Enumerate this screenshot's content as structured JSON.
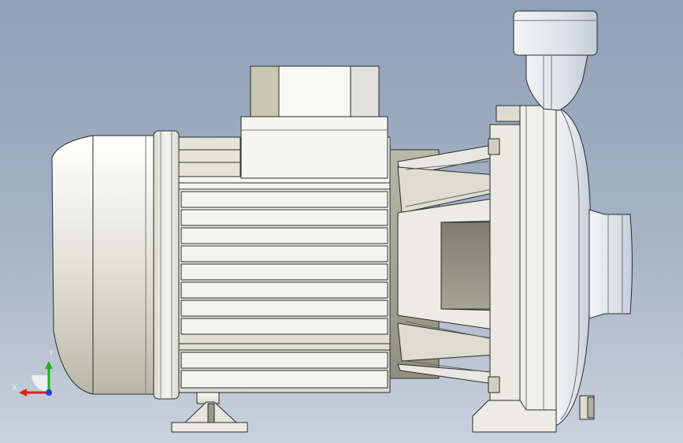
{
  "viewport": {
    "background_top": "#8f9fb6",
    "background_bottom": "#c9d2dd"
  },
  "model": {
    "name": "centrifugal-pump-with-motor",
    "body_color": "#eeeeea",
    "edge_color": "#2b2b2b"
  },
  "triad": {
    "x_label": "X",
    "y_label": "Y",
    "x_color": "#e02020",
    "y_color": "#20b020",
    "z_color": "#2040d0"
  }
}
